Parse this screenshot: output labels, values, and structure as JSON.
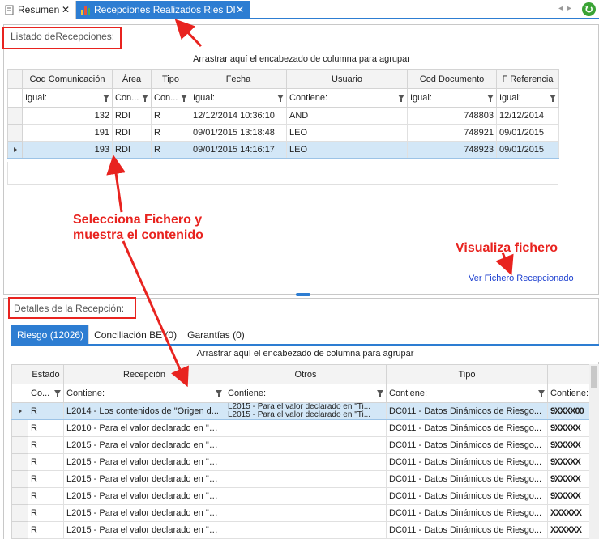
{
  "tabs": [
    {
      "label": "Resumen",
      "close": "✕"
    },
    {
      "label": "Recepciones Realizados Ries DI",
      "close": "✕"
    }
  ],
  "top": {
    "group_title": "Listado deRecepciones:",
    "group_area": "Arrastrar aquí el encabezado de columna para agrupar",
    "columns": [
      "Cod Comunicación",
      "Área",
      "Tipo",
      "Fecha",
      "Usuario",
      "Cod Documento",
      "F Referencia"
    ],
    "filters": [
      "Igual:",
      "Con...",
      "Con...",
      "Igual:",
      "Contiene:",
      "Igual:",
      "Igual:"
    ],
    "rows": [
      [
        "132",
        "RDI",
        "R",
        "12/12/2014 10:36:10",
        "AND",
        "748803",
        "12/12/2014"
      ],
      [
        "191",
        "RDI",
        "R",
        "09/01/2015 13:18:48",
        "LEO",
        "748921",
        "09/01/2015"
      ],
      [
        "193",
        "RDI",
        "R",
        "09/01/2015 14:16:17",
        "LEO",
        "748923",
        "09/01/2015"
      ]
    ],
    "link": "Ver Fichero Recepcionado"
  },
  "bottom": {
    "group_title": "Detalles de la Recepción:",
    "tabs": [
      "Riesgo (12026)",
      "Conciliación BE (0)",
      "Garantías (0)"
    ],
    "group_area": "Arrastrar aquí el encabezado de columna para agrupar",
    "columns": [
      "Estado",
      "Recepción",
      "Otros",
      "Tipo"
    ],
    "filters": [
      "Co...",
      "Contiene:",
      "Contiene:",
      "Contiene:",
      "Contiene:"
    ],
    "row1": {
      "estado": "R",
      "recepcion": "L2014 - Los contenidos de \"Origen d...",
      "otros_1": "L2015 - Para el valor declarado en \"Ti...",
      "otros_2": "L2015 - Para el valor declarado en \"Ti...",
      "tipo": "DC011 - Datos Dinámicos de Riesgo...",
      "masked": "9XXXX00"
    },
    "rows": [
      [
        "R",
        "L2010 - Para el valor declarado en \"Ti...",
        "",
        "DC011 - Datos Dinámicos de Riesgo...",
        "9XXXXX"
      ],
      [
        "R",
        "L2015 - Para el valor declarado en \"Ti...",
        "",
        "DC011 - Datos Dinámicos de Riesgo...",
        "9XXXXX"
      ],
      [
        "R",
        "L2015 - Para el valor declarado en \"Ti...",
        "",
        "DC011 - Datos Dinámicos de Riesgo...",
        "9XXXXX"
      ],
      [
        "R",
        "L2015 - Para el valor declarado en \"Ti...",
        "",
        "DC011 - Datos Dinámicos de Riesgo...",
        "9XXXXX"
      ],
      [
        "R",
        "L2015 - Para el valor declarado en \"Ti...",
        "",
        "DC011 - Datos Dinámicos de Riesgo...",
        "9XXXXX"
      ],
      [
        "R",
        "L2015 - Para el valor declarado en \"Ti...",
        "",
        "DC011 - Datos Dinámicos de Riesgo...",
        "XXXXXX"
      ],
      [
        "R",
        "L2015 - Para el valor declarado en \"Ti...",
        "",
        "DC011 - Datos Dinámicos de Riesgo...",
        "XXXXXX"
      ]
    ]
  },
  "annotations": {
    "select_line1": "Selecciona Fichero y",
    "select_line2": "muestra el contenido",
    "visualiza": "Visualiza fichero"
  },
  "colors": {
    "accent": "#2d7dd2",
    "annotation": "#e8231f",
    "selected_row": "#d3e7f7",
    "link": "#1c3fcf"
  },
  "icons": {
    "resumen_tab": "document-icon",
    "recep_tab": "bar-chart-icon",
    "refresh": "refresh-icon"
  }
}
